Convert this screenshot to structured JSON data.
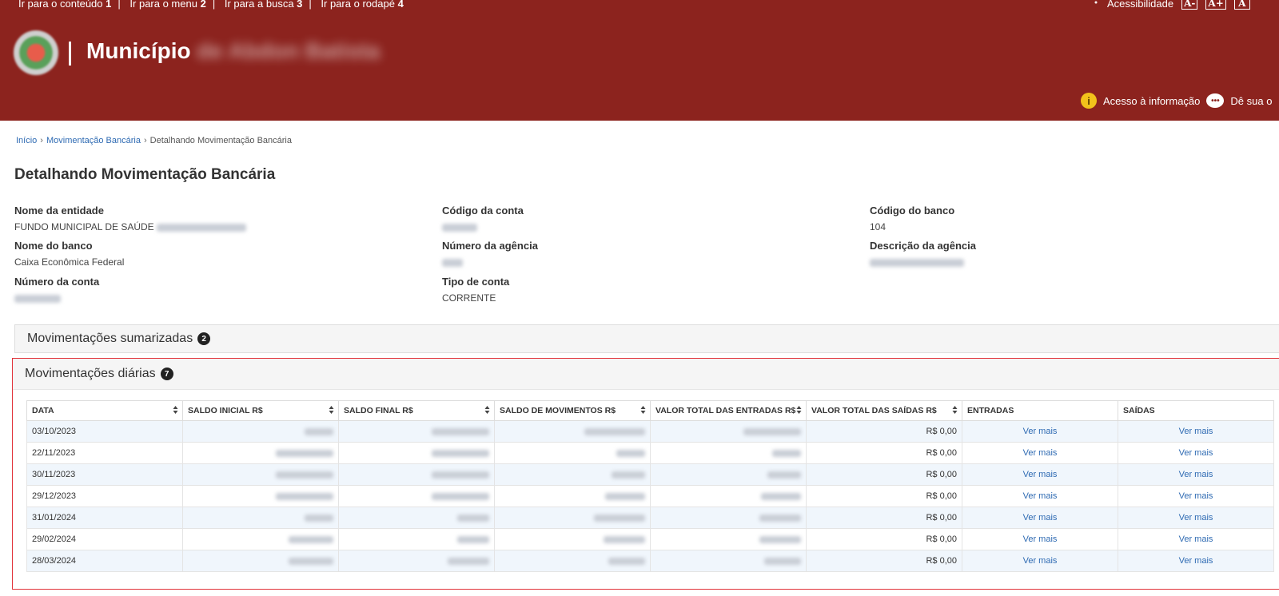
{
  "skiplinks": [
    {
      "label": "Ir para o conteúdo",
      "key": "1"
    },
    {
      "label": "Ir para o menu",
      "key": "2"
    },
    {
      "label": "Ir para a busca",
      "key": "3"
    },
    {
      "label": "Ir para o rodapé",
      "key": "4"
    }
  ],
  "header": {
    "brand": "Município",
    "accessibility_label": "Acessibilidade",
    "font_buttons": [
      "A-",
      "A+",
      "A"
    ],
    "access_info": "Acesso à informação",
    "feedback": "Dê sua o"
  },
  "breadcrumb": {
    "home": "Início",
    "parent": "Movimentação Bancária",
    "current": "Detalhando Movimentação Bancária"
  },
  "page_title": "Detalhando Movimentação Bancária",
  "fields": {
    "entity_label": "Nome da entidade",
    "entity_value": "FUNDO MUNICIPAL DE SAÚDE",
    "account_code_label": "Código da conta",
    "bank_code_label": "Código do banco",
    "bank_code_value": "104",
    "bank_name_label": "Nome do banco",
    "bank_name_value": "Caixa Econômica Federal",
    "agency_number_label": "Número da agência",
    "agency_desc_label": "Descrição da agência",
    "account_number_label": "Número da conta",
    "account_type_label": "Tipo de conta",
    "account_type_value": "CORRENTE"
  },
  "panels": {
    "summarized_title": "Movimentações sumarizadas",
    "summarized_badge": "2",
    "daily_title": "Movimentações diárias",
    "daily_badge": "7"
  },
  "table": {
    "columns": [
      "DATA",
      "SALDO INICIAL R$",
      "SALDO FINAL R$",
      "SALDO DE MOVIMENTOS R$",
      "VALOR TOTAL DAS ENTRADAS R$",
      "VALOR TOTAL DAS SAÍDAS R$",
      "ENTRADAS",
      "SAÍDAS"
    ],
    "rows": [
      {
        "date": "03/10/2023",
        "saidas_total": "R$ 0,00",
        "entradas": "Ver mais",
        "saidas": "Ver mais"
      },
      {
        "date": "22/11/2023",
        "saidas_total": "R$ 0,00",
        "entradas": "Ver mais",
        "saidas": "Ver mais"
      },
      {
        "date": "30/11/2023",
        "saidas_total": "R$ 0,00",
        "entradas": "Ver mais",
        "saidas": "Ver mais"
      },
      {
        "date": "29/12/2023",
        "saidas_total": "R$ 0,00",
        "entradas": "Ver mais",
        "saidas": "Ver mais"
      },
      {
        "date": "31/01/2024",
        "saidas_total": "R$ 0,00",
        "entradas": "Ver mais",
        "saidas": "Ver mais"
      },
      {
        "date": "29/02/2024",
        "saidas_total": "R$ 0,00",
        "entradas": "Ver mais",
        "saidas": "Ver mais"
      },
      {
        "date": "28/03/2024",
        "saidas_total": "R$ 0,00",
        "entradas": "Ver mais",
        "saidas": "Ver mais"
      }
    ]
  }
}
